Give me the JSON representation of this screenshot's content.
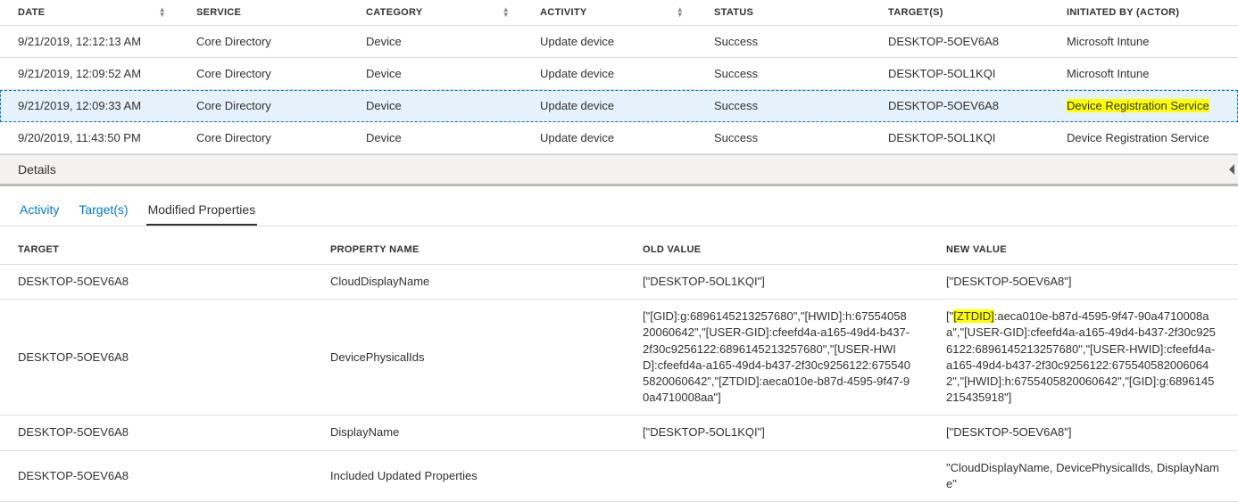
{
  "audit": {
    "headers": {
      "date": "DATE",
      "service": "SERVICE",
      "category": "CATEGORY",
      "activity": "ACTIVITY",
      "status": "STATUS",
      "targets": "TARGET(S)",
      "actor": "INITIATED BY (ACTOR)"
    },
    "rows": [
      {
        "date": "9/21/2019, 12:12:13 AM",
        "service": "Core Directory",
        "category": "Device",
        "activity": "Update device",
        "status": "Success",
        "targets": "DESKTOP-5OEV6A8",
        "actor": "Microsoft Intune"
      },
      {
        "date": "9/21/2019, 12:09:52 AM",
        "service": "Core Directory",
        "category": "Device",
        "activity": "Update device",
        "status": "Success",
        "targets": "DESKTOP-5OL1KQI",
        "actor": "Microsoft Intune"
      },
      {
        "date": "9/21/2019, 12:09:33 AM",
        "service": "Core Directory",
        "category": "Device",
        "activity": "Update device",
        "status": "Success",
        "targets": "DESKTOP-5OEV6A8",
        "actor": "Device Registration Service"
      },
      {
        "date": "9/20/2019, 11:43:50 PM",
        "service": "Core Directory",
        "category": "Device",
        "activity": "Update device",
        "status": "Success",
        "targets": "DESKTOP-5OL1KQI",
        "actor": "Device Registration Service"
      }
    ]
  },
  "details": {
    "label": "Details"
  },
  "tabs": {
    "activity": "Activity",
    "targets": "Target(s)",
    "modified": "Modified Properties"
  },
  "props": {
    "headers": {
      "target": "TARGET",
      "property": "PROPERTY NAME",
      "old": "OLD VALUE",
      "new": "NEW VALUE"
    },
    "rows": [
      {
        "target": "DESKTOP-5OEV6A8",
        "property": "CloudDisplayName",
        "old": "[\"DESKTOP-5OL1KQI\"]",
        "new": "[\"DESKTOP-5OEV6A8\"]"
      },
      {
        "target": "DESKTOP-5OEV6A8",
        "property": "DevicePhysicalIds",
        "old": "[\"[GID]:g:6896145213257680\",\"[HWID]:h:6755405820060642\",\"[USER-GID]:cfeefd4a-a165-49d4-b437-2f30c9256122:6896145213257680\",\"[USER-HWID]:cfeefd4a-a165-49d4-b437-2f30c9256122:6755405820060642\",\"[ZTDID]:aeca010e-b87d-4595-9f47-90a4710008aa\"]",
        "new_hl": "[ZTDID]",
        "new_prefix": "[\"",
        "new_rest": ":aeca010e-b87d-4595-9f47-90a4710008aa\",\"[USER-GID]:cfeefd4a-a165-49d4-b437-2f30c9256122:6896145213257680\",\"[USER-HWID]:cfeefd4a-a165-49d4-b437-2f30c9256122:6755405820060642\",\"[HWID]:h:6755405820060642\",\"[GID]:g:6896145215435918\"]"
      },
      {
        "target": "DESKTOP-5OEV6A8",
        "property": "DisplayName",
        "old": "[\"DESKTOP-5OL1KQI\"]",
        "new": "[\"DESKTOP-5OEV6A8\"]"
      },
      {
        "target": "DESKTOP-5OEV6A8",
        "property": "Included Updated Properties",
        "old": "",
        "new": "\"CloudDisplayName, DevicePhysicalIds, DisplayName\""
      }
    ]
  }
}
